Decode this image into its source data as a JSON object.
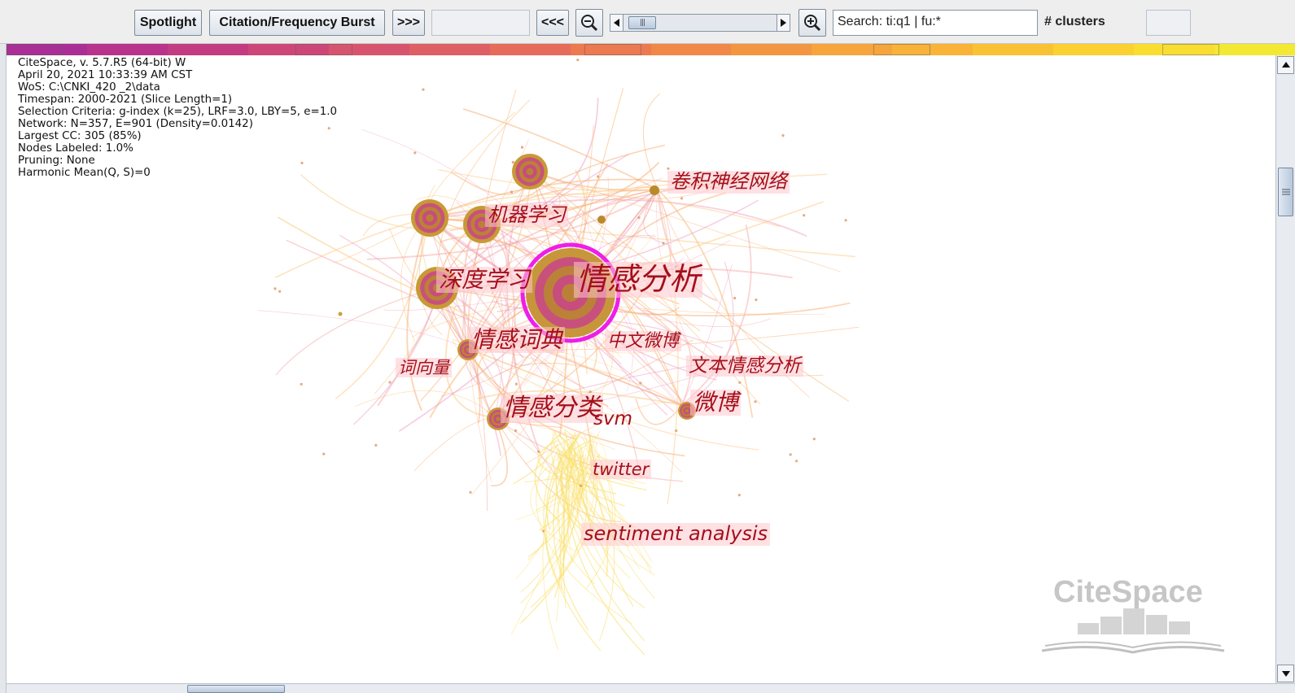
{
  "toolbar": {
    "spotlight_label": "Spotlight",
    "burst_label": "Citation/Frequency Burst",
    "forward_label": ">>>",
    "back_label": "<<<",
    "search_value": "Search: ti:q1 | fu:*",
    "clusters_label": "# clusters",
    "zoom_out_icon": "zoom-out-icon",
    "zoom_in_icon": "zoom-in-icon"
  },
  "info_lines": [
    "CiteSpace, v. 5.7.R5 (64-bit) W",
    "April 20, 2021 10:33:39 AM CST",
    "WoS: C:\\CNKI_420 _2\\data",
    "Timespan: 2000-2021 (Slice Length=1)",
    "Selection Criteria: g-index (k=25), LRF=3.0, LBY=5, e=1.0",
    "Network: N=357, E=901 (Density=0.0142)",
    "Largest CC: 305 (85%)",
    "Nodes Labeled: 1.0%",
    "Pruning: None",
    "Harmonic Mean(Q, S)=0"
  ],
  "timeline_colors": [
    "#a92f96",
    "#b8348c",
    "#c23c82",
    "#cc4778",
    "#d6546e",
    "#de6064",
    "#e56c5a",
    "#ec7950",
    "#f08848",
    "#f39641",
    "#f6a43c",
    "#f8b338",
    "#f9c234",
    "#fad032",
    "#f9de31",
    "#f3e832"
  ],
  "keywords": [
    {
      "id": "qingganfenxi",
      "label": "情感分析"
    },
    {
      "id": "shenduxuexi",
      "label": "深度学习"
    },
    {
      "id": "jiqixuexi",
      "label": "机器学习"
    },
    {
      "id": "juanjishenjingwangluo",
      "label": "卷积神经网络"
    },
    {
      "id": "qingganci",
      "label": "情感词典"
    },
    {
      "id": "zhongwenweibo",
      "label": "中文微博"
    },
    {
      "id": "wenbenqingganfenxi",
      "label": "文本情感分析"
    },
    {
      "id": "cixiangliang",
      "label": "词向量"
    },
    {
      "id": "qingganfenlei",
      "label": "情感分类"
    },
    {
      "id": "svm",
      "label": "svm"
    },
    {
      "id": "weibo",
      "label": "微博"
    },
    {
      "id": "twitter",
      "label": "twitter"
    },
    {
      "id": "sentiment",
      "label": "sentiment analysis"
    }
  ],
  "watermark": {
    "text": "CiteSpace"
  }
}
